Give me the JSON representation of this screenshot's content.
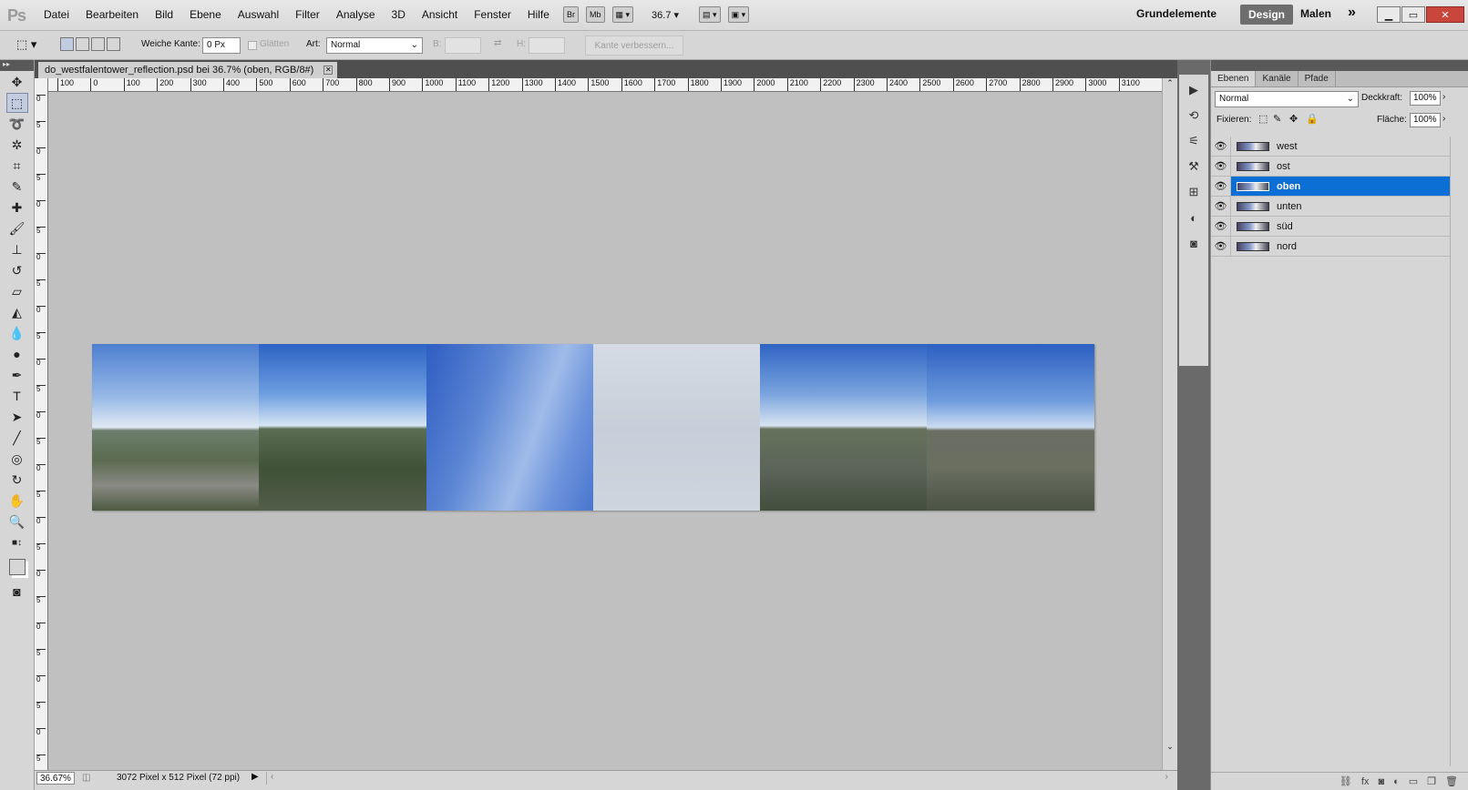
{
  "app": {
    "logo": "Ps"
  },
  "menu": [
    "Datei",
    "Bearbeiten",
    "Bild",
    "Ebene",
    "Auswahl",
    "Filter",
    "Analyse",
    "3D",
    "Ansicht",
    "Fenster",
    "Hilfe"
  ],
  "menubar": {
    "br": "Br",
    "mb": "Mb",
    "zoom": "36.7",
    "ws_essentials": "Grundelemente",
    "ws_design": "Design",
    "ws_paint": "Malen",
    "more": "»"
  },
  "options": {
    "feather_label": "Weiche Kante:",
    "feather_value": "0 Px",
    "antialias_label": "Glätten",
    "style_label": "Art:",
    "style_value": "Normal",
    "width_label": "B:",
    "height_label": "H:",
    "refine_label": "Kante verbessern..."
  },
  "document": {
    "tab_title": "do_westfalentower_reflection.psd bei 36.7% (oben, RGB/8#)",
    "zoom": "36.67%",
    "info": "3072 Pixel x 512 Pixel (72 ppi)"
  },
  "ruler": {
    "h_labels": [
      "100",
      "0",
      "100",
      "200",
      "300",
      "400",
      "500",
      "600",
      "700",
      "800",
      "900",
      "1000",
      "1100",
      "1200",
      "1300",
      "1400",
      "1500",
      "1600",
      "1700",
      "1800",
      "1900",
      "2000",
      "2100",
      "2200",
      "2300",
      "2400",
      "2500",
      "2600",
      "2700",
      "2800",
      "2900",
      "3000",
      "3100"
    ],
    "v_labels": [
      "0",
      "5",
      "0",
      "5",
      "0",
      "5",
      "0",
      "5",
      "0",
      "5",
      "0",
      "5",
      "0",
      "5",
      "0",
      "5",
      "0",
      "5",
      "0",
      "5",
      "0",
      "5",
      "0",
      "5",
      "0",
      "5"
    ]
  },
  "layers_panel": {
    "tabs": [
      "Ebenen",
      "Kanäle",
      "Pfade"
    ],
    "blend_mode": "Normal",
    "opacity_label": "Deckkraft:",
    "opacity_value": "100%",
    "lock_label": "Fixieren:",
    "fill_label": "Fläche:",
    "fill_value": "100%",
    "layers": [
      {
        "name": "west"
      },
      {
        "name": "ost"
      },
      {
        "name": "oben",
        "selected": true
      },
      {
        "name": "unten"
      },
      {
        "name": "süd"
      },
      {
        "name": "nord"
      }
    ]
  },
  "colors": {
    "selection": "#0b6fd6",
    "canvas_bg": "#c0c0c0",
    "chrome": "#d6d6d6"
  }
}
